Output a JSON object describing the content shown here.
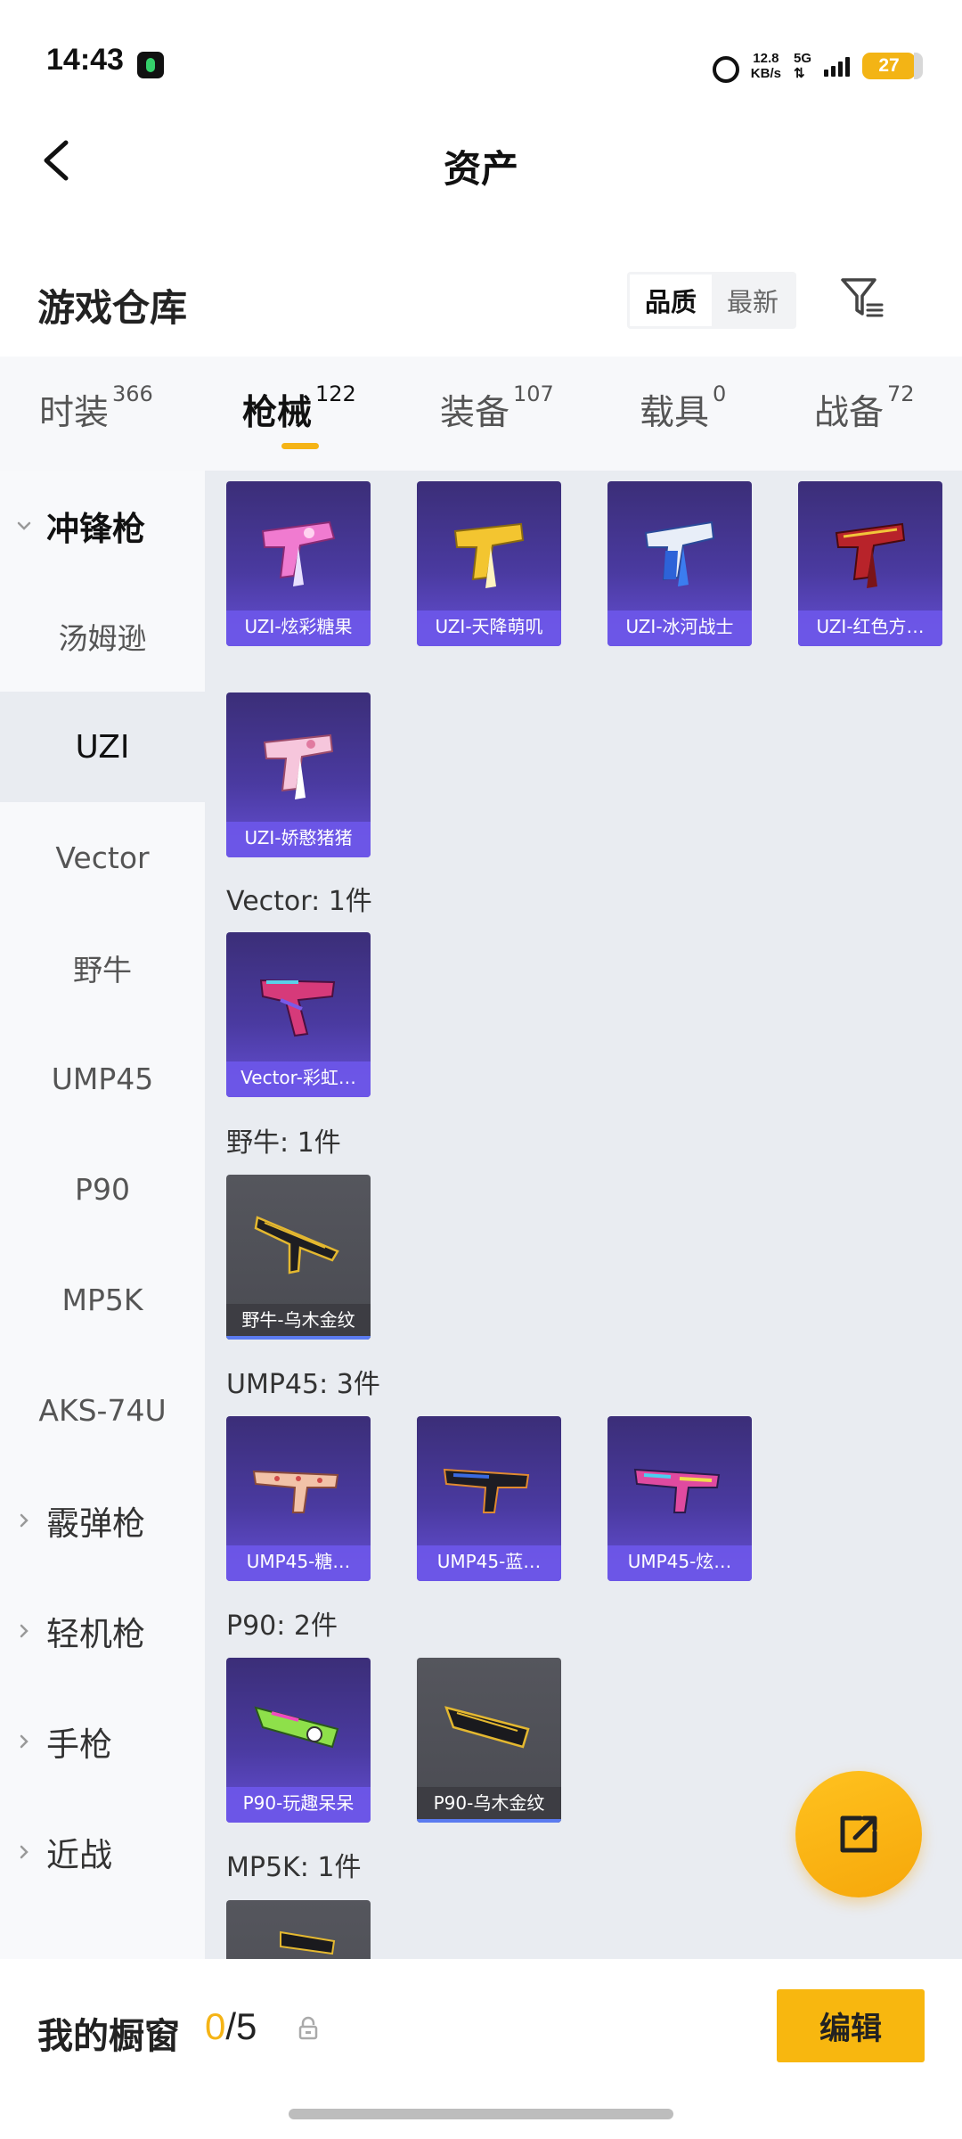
{
  "status_bar": {
    "time": "14:43",
    "net_speed_value": "12.8",
    "net_speed_unit": "KB/s",
    "network": "5G",
    "battery": "27"
  },
  "header": {
    "title": "资产",
    "back_icon": "chevron-left-icon"
  },
  "section": {
    "title": "游戏仓库",
    "sort_options": [
      "品质",
      "最新"
    ],
    "sort_selected": "品质",
    "filter_icon": "filter-icon"
  },
  "tabs": [
    {
      "label": "时装",
      "count": "366"
    },
    {
      "label": "枪械",
      "count": "122",
      "active": true
    },
    {
      "label": "装备",
      "count": "107"
    },
    {
      "label": "载具",
      "count": "0"
    },
    {
      "label": "战备",
      "count": "72"
    }
  ],
  "side_nav": {
    "items": [
      {
        "label": "冲锋枪",
        "type": "group",
        "expanded": true
      },
      {
        "label": "汤姆逊",
        "type": "sub"
      },
      {
        "label": "UZI",
        "type": "sub",
        "selected": true
      },
      {
        "label": "Vector",
        "type": "sub"
      },
      {
        "label": "野牛",
        "type": "sub"
      },
      {
        "label": "UMP45",
        "type": "sub"
      },
      {
        "label": "P90",
        "type": "sub"
      },
      {
        "label": "MP5K",
        "type": "sub"
      },
      {
        "label": "AKS-74U",
        "type": "sub"
      },
      {
        "label": "霰弹枪",
        "type": "group"
      },
      {
        "label": "轻机枪",
        "type": "group"
      },
      {
        "label": "手枪",
        "type": "group"
      },
      {
        "label": "近战",
        "type": "group"
      }
    ]
  },
  "content": {
    "uzi_items": [
      {
        "name": "UZI-炫彩糖果"
      },
      {
        "name": "UZI-天降萌叽"
      },
      {
        "name": "UZI-冰河战士"
      },
      {
        "name": "UZI-红色方…"
      },
      {
        "name": "UZI-娇憨猪猪"
      }
    ],
    "groups": {
      "vector": {
        "label": "Vector: 1件",
        "items": [
          {
            "name": "Vector-彩虹…"
          }
        ]
      },
      "bison": {
        "label": "野牛: 1件",
        "items": [
          {
            "name": "野牛-乌木金纹"
          }
        ]
      },
      "ump45": {
        "label": "UMP45: 3件",
        "items": [
          {
            "name": "UMP45-糖…"
          },
          {
            "name": "UMP45-蓝…"
          },
          {
            "name": "UMP45-炫…"
          }
        ]
      },
      "p90": {
        "label": "P90: 2件",
        "items": [
          {
            "name": "P90-玩趣呆呆"
          },
          {
            "name": "P90-乌木金纹"
          }
        ]
      },
      "mp5k": {
        "label": "MP5K: 1件"
      }
    }
  },
  "fab": {
    "icon": "share-external-icon"
  },
  "bottom_bar": {
    "label": "我的橱窗",
    "current": "0",
    "total_text": "/5",
    "lock_icon": "lock-icon",
    "edit_label": "编辑"
  },
  "colors": {
    "accent": "#f5b416",
    "card_purple": "#4a3aa0",
    "card_grey": "#4a4b52"
  }
}
